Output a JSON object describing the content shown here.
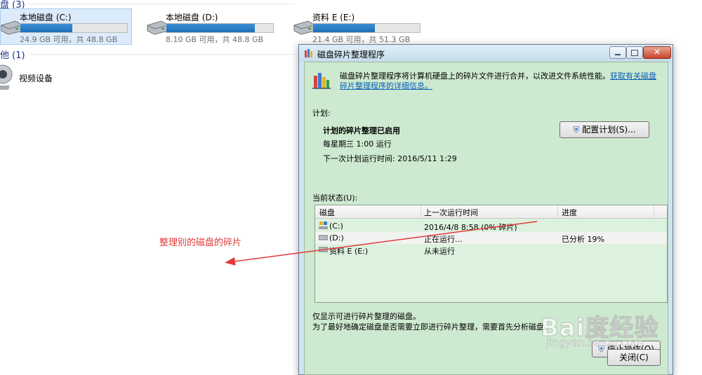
{
  "explorer": {
    "section_disk_label": "盘 (3)",
    "section_other_label": "他 (1)",
    "drives": [
      {
        "name": "本地磁盘 (C:)",
        "info": "24.9 GB 可用，共 48.8 GB",
        "used_fraction": 0.49
      },
      {
        "name": "本地磁盘 (D:)",
        "info": "8.10 GB 可用，共 48.8 GB",
        "used_fraction": 0.83
      },
      {
        "name": "资料 E (E:)",
        "info": "21.4 GB 可用，共 51.3 GB",
        "used_fraction": 0.58
      }
    ],
    "other_device": "视频设备"
  },
  "dialog": {
    "title": "磁盘碎片整理程序",
    "intro_text": "磁盘碎片整理程序将计算机硬盘上的碎片文件进行合并，以改进文件系统性能。",
    "intro_link": "获取有关磁盘碎片整理程序的详细信息。",
    "schedule_label": "计划:",
    "schedule_status": "计划的碎片整理已启用",
    "schedule_time": "每星期三 1:00 运行",
    "next_run": "下一次计划运行时间: 2016/5/11 1:29",
    "configure_button": "配置计划(S)...",
    "current_status_label": "当前状态(U):",
    "columns": [
      "磁盘",
      "上一次运行时间",
      "进度"
    ],
    "rows": [
      {
        "disk": "(C:)",
        "last_run": "2016/4/8 8:58 (0% 碎片)",
        "progress": ""
      },
      {
        "disk": "(D:)",
        "last_run": "正在运行...",
        "progress": "已分析 19%"
      },
      {
        "disk": "资料 E (E:)",
        "last_run": "从未运行",
        "progress": ""
      }
    ],
    "footer_note1": "仅显示可进行碎片整理的磁盘。",
    "footer_note2": "为了最好地确定磁盘是否需要立即进行碎片整理，需要首先分析磁盘。",
    "stop_button": "停止操作(O)",
    "close_button": "关闭(C)"
  },
  "annotation": {
    "text": "整理别的磁盘的碎片",
    "color": "#e23a3a"
  },
  "watermark": {
    "brand": "Bai度经验",
    "url": "jingyan.baidu.com"
  }
}
